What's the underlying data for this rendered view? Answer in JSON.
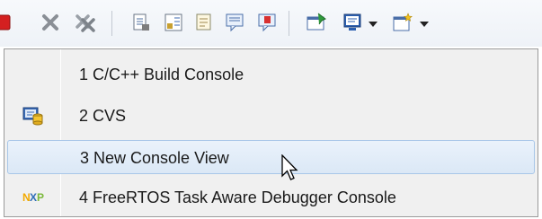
{
  "toolbar": {
    "icons": [
      "stop-icon",
      "remove-launch-icon",
      "remove-all-terminated-icon",
      "scroll-lock-icon",
      "word-wrap-icon",
      "clear-console-icon",
      "show-on-stdout-icon",
      "show-on-stderr-icon",
      "pin-console-icon",
      "display-selected-console-icon",
      "open-console-icon"
    ]
  },
  "menu": {
    "items": [
      {
        "label": "1 C/C++ Build Console",
        "icon": ""
      },
      {
        "label": "2 CVS",
        "icon": "cvs-database-icon"
      },
      {
        "label": "3 New Console View",
        "icon": "",
        "highlighted": true
      },
      {
        "label": "4 FreeRTOS Task Aware Debugger Console",
        "icon": "nxp-logo-icon"
      }
    ]
  },
  "colors": {
    "menu_bg": "#f0f0f0",
    "highlight_bg": "#dbe8f6",
    "highlight_border": "#a8c6e8",
    "stop_red": "#d42020",
    "pin_green": "#2f9a3c",
    "monitor_blue": "#2b5fb0"
  }
}
